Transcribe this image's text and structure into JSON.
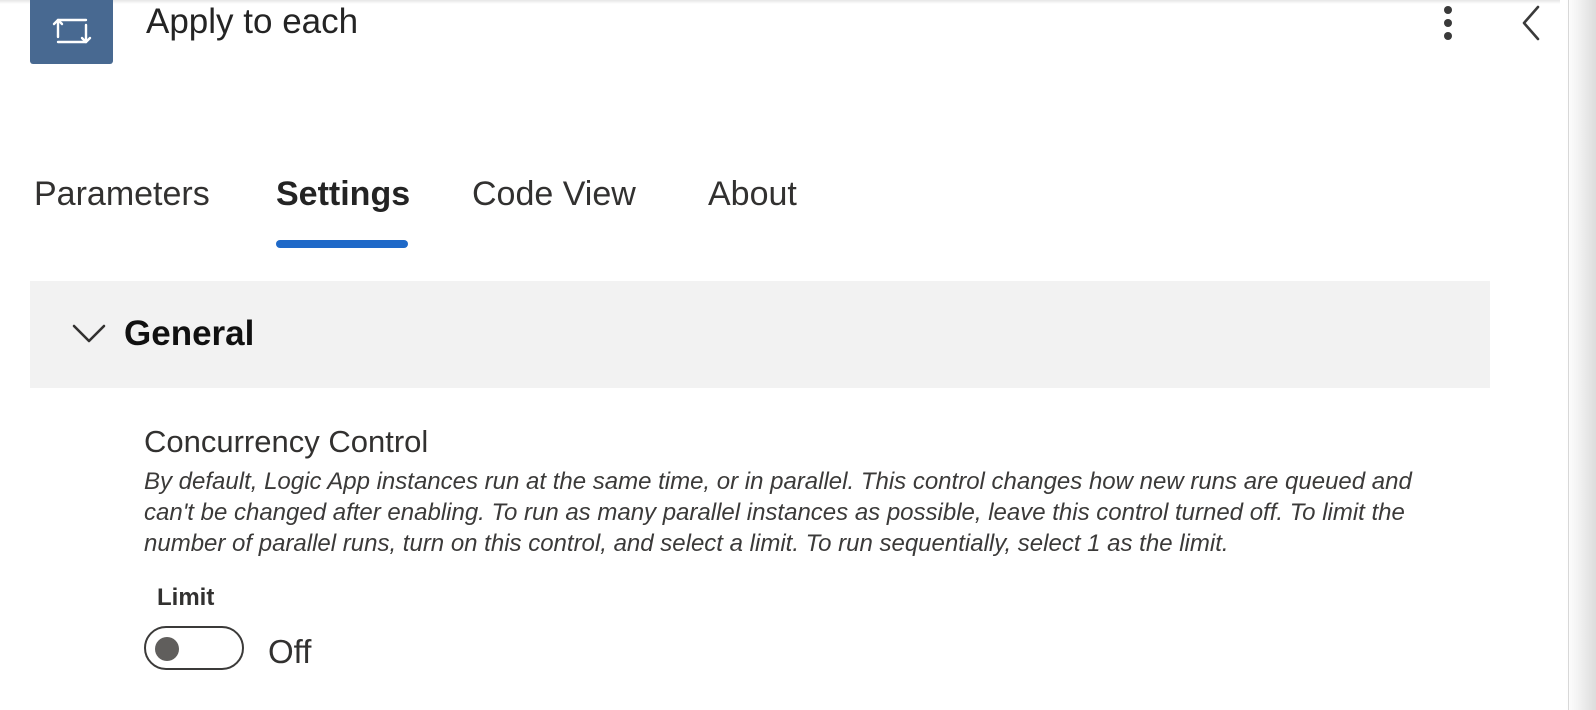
{
  "header": {
    "title": "Apply to each",
    "icon": "loop-icon",
    "icon_bg": "#486991",
    "more_icon": "more-vertical-icon",
    "collapse_icon": "chevron-left-icon"
  },
  "tabs": [
    {
      "label": "Parameters",
      "active": false
    },
    {
      "label": "Settings",
      "active": true
    },
    {
      "label": "Code View",
      "active": false
    },
    {
      "label": "About",
      "active": false
    }
  ],
  "accent": "#1f69c8",
  "section": {
    "title": "General",
    "expanded": true,
    "icon": "chevron-down-icon"
  },
  "concurrency": {
    "title": "Concurrency Control",
    "description": "By default, Logic App instances run at the same time, or in parallel. This control changes how new runs are queued and can't be changed after enabling. To run as many parallel instances as possible, leave this control turned off. To limit the number of parallel runs, turn on this control, and select a limit. To run sequentially, select 1 as the limit.",
    "limit_label": "Limit",
    "toggle_on": false,
    "toggle_state_text": "Off"
  }
}
